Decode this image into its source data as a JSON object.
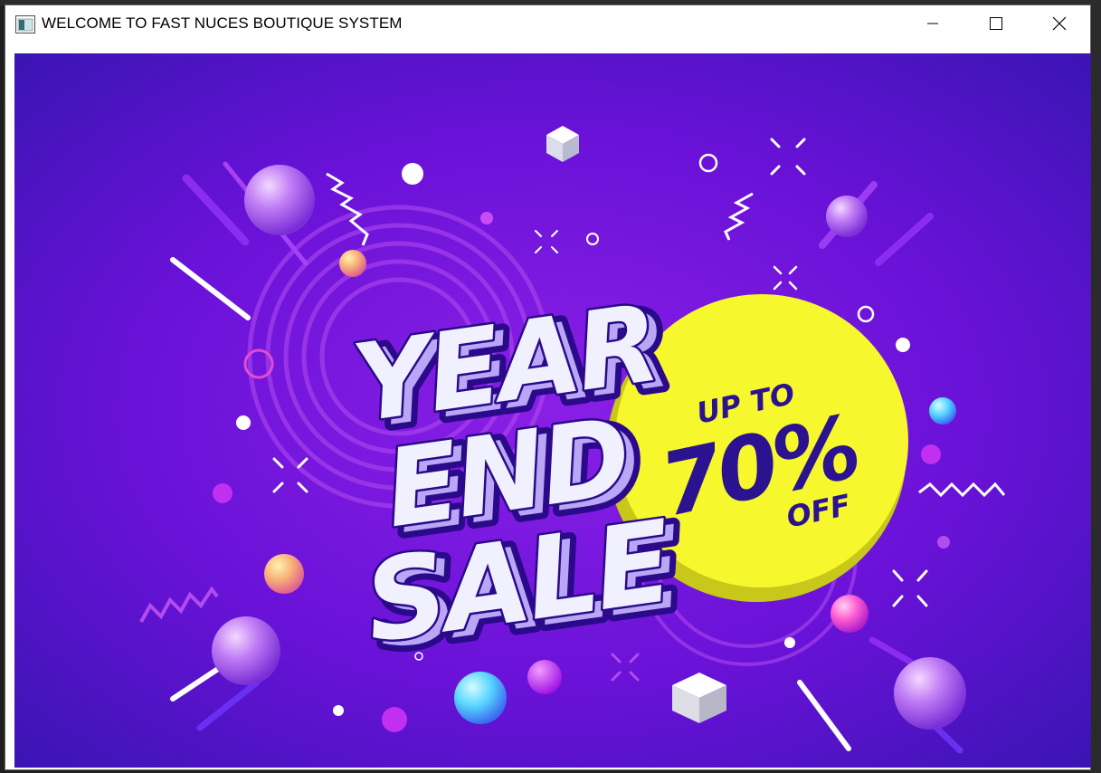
{
  "window": {
    "title": "WELCOME TO FAST NUCES BOUTIQUE SYSTEM",
    "icon": "app-window-icon",
    "controls": {
      "minimize": "minimize-icon",
      "maximize": "maximize-icon",
      "close": "close-icon"
    }
  },
  "banner": {
    "line1": "YEAR",
    "line2": "END",
    "line3": "SALE",
    "badge_top": "UP TO",
    "badge_value": "70%",
    "badge_bottom": "OFF",
    "colors": {
      "background": "#6a12d8",
      "background_dark": "#3b0fb0",
      "badge": "#f7f72e",
      "badge_text": "#2a1290",
      "headline_fill": "#f1f0ff",
      "headline_outline": "#2a0a8a"
    }
  }
}
